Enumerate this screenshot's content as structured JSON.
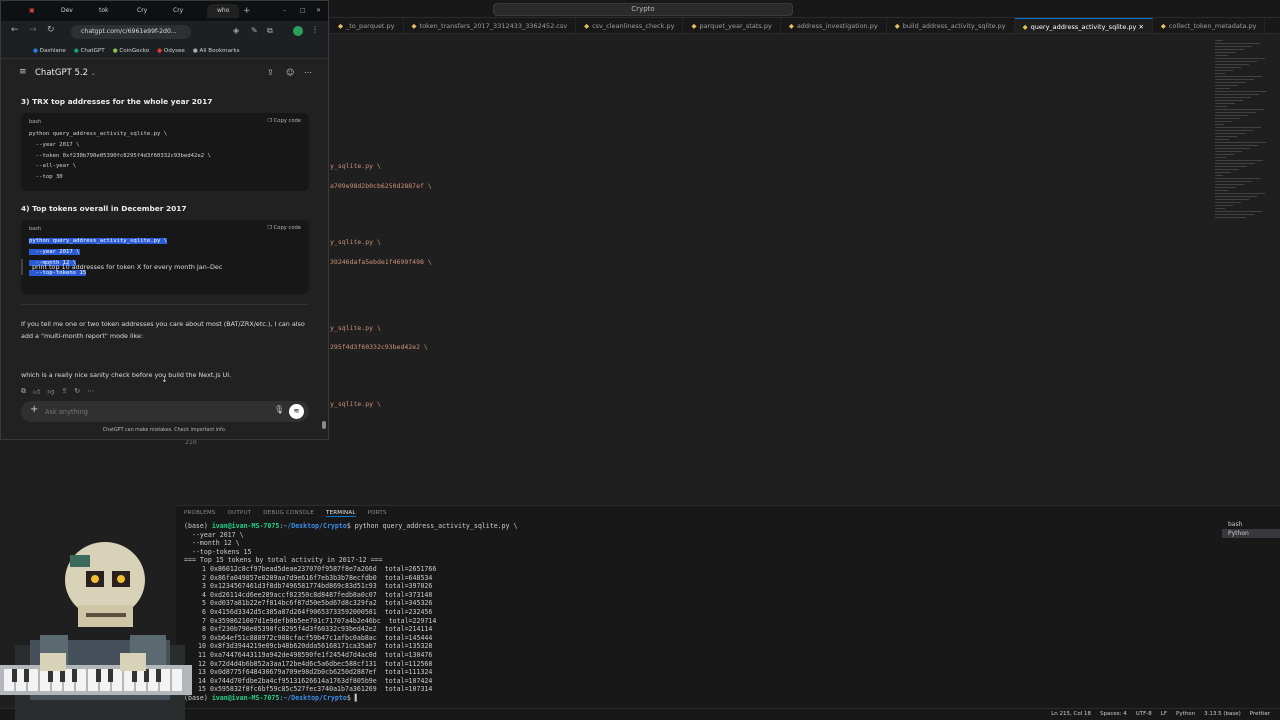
{
  "vscode": {
    "search_text": "Crypto",
    "tabs": [
      {
        "label": "_to_parquet.py",
        "active": false
      },
      {
        "label": "token_transfers_2017_3312433_3362452.csv",
        "active": false
      },
      {
        "label": "csv_cleanliness_check.py",
        "active": false
      },
      {
        "label": "parquet_year_stats.py",
        "active": false
      },
      {
        "label": "address_investigation.py",
        "active": false
      },
      {
        "label": "build_address_activity_sqlite.py",
        "active": false
      },
      {
        "label": "query_address_activity_sqlite.py",
        "active": true
      },
      {
        "label": "collect_token_metadata.py",
        "active": false
      }
    ],
    "code_fragments": [
      "y_sqlite.py \\",
      "a709e98d2b0cb6250d2887ef \\",
      "y_sqlite.py \\",
      "39246dafa5ebde1f4699f498 \\",
      "y_sqlite.py \\",
      "295f4d3f60332c93bed42e2 \\",
      "y_sqlite.py \\"
    ],
    "line_number": "210",
    "panel_tabs": [
      "PROBLEMS",
      "OUTPUT",
      "DEBUG CONSOLE",
      "TERMINAL",
      "PORTS"
    ],
    "terminal": {
      "prompt_user": "ivan@ivan-MS-7075",
      "prompt_path": "~/Desktop/Crypto",
      "env": "(base)",
      "command": "$ python query_address_activity_sqlite.py \\",
      "args": [
        "  --year 2017 \\",
        "  --month 12 \\",
        "  --top-tokens 15"
      ],
      "header": "=== Top 15 tokens by total activity in 2017-12 ===",
      "rows": [
        {
          "rank": "1",
          "address": "0x86012c8cf97bead5deae237070f9587f8e7a266d",
          "total": "total=2651766"
        },
        {
          "rank": "2",
          "address": "0x86fa049857e0209aa7d9e616f7eb3b3b78ecfdb0",
          "total": "total=648534"
        },
        {
          "rank": "3",
          "address": "0x1234567461d3f8db7496581774bd869c83d51c93",
          "total": "total=397026"
        },
        {
          "rank": "4",
          "address": "0xd26114cd6ee289accf82350c8d8487fedb8a0c07",
          "total": "total=373148"
        },
        {
          "rank": "5",
          "address": "0xd037a81b22e7f814bc6f87d50e5bd67d8c329fa2",
          "total": "total=345326"
        },
        {
          "rank": "6",
          "address": "0x4156d3342d5c385a87d264f90653733592000581",
          "total": "total=232456"
        },
        {
          "rank": "7",
          "address": "0x3598621007d1e9defb0b5ee701c71707a4b2e46bc",
          "total": "total=229714"
        },
        {
          "rank": "8",
          "address": "0xf230b790e05390fc8295f4d3f60332c93bed42e2",
          "total": "total=214114"
        },
        {
          "rank": "9",
          "address": "0xb64ef51c888972c908cfacf59b47c1afbc0ab8ac",
          "total": "total=145444"
        },
        {
          "rank": "10",
          "address": "0x8f3d3944219e09cb48b620dda56168171ca35ab7",
          "total": "total=135328"
        },
        {
          "rank": "11",
          "address": "0xa74476443119a942de498590fe1f2454d7d4ac0d",
          "total": "total=130476"
        },
        {
          "rank": "12",
          "address": "0x72d4d4b6b852a3aa172be4d6c5a6dbec588cf131",
          "total": "total=112568"
        },
        {
          "rank": "13",
          "address": "0x0d8775f648430679a709e98d2b0cb6250d2887ef",
          "total": "total=111324"
        },
        {
          "rank": "14",
          "address": "0x744d70fdbe2ba4cf95131626614a1763df805b9e",
          "total": "total=107424"
        },
        {
          "rank": "15",
          "address": "0x595832f8fc6bf59c85c527fec3740a1b7a361269",
          "total": "total=107314"
        }
      ],
      "final_prompt": "$"
    },
    "terminal_list": [
      "bash",
      "Python"
    ],
    "status": [
      "Ln 215, Col 18",
      "Spaces: 4",
      "UTF-8",
      "LF",
      "Python",
      "3.13.5 (base)",
      "Prettier"
    ]
  },
  "chrome": {
    "tabs": [
      "Dev",
      "tok",
      "Cry",
      "Cry",
      "who"
    ],
    "url": "chatgpt.com/c/6961e99f-2d0...",
    "bookmarks": [
      "Dashlane",
      "ChatGPT",
      "CoinGecko",
      "Odysee",
      "All Bookmarks"
    ],
    "app_title": "ChatGPT 5.2",
    "sections": [
      {
        "heading": "3) TRX top addresses for the whole year 2017",
        "lang": "bash",
        "copy": "Copy code",
        "code": "python query_address_activity_sqlite.py \\\n  --year 2017 \\\n  --token 0xf230b790e05390fc8295f4d3f60332c93bed42e2 \\\n  --all-year \\\n  --top 30"
      },
      {
        "heading": "4) Top tokens overall in December 2017",
        "lang": "bash",
        "copy": "Copy code",
        "code": "python query_address_activity_sqlite.py \\\n  --year 2017 \\\n  --month 12 \\\n  --top-tokens 15"
      }
    ],
    "paragraph": "If you tell me one or two token addresses you care about most (BAT/ZRX/etc.), I can also add a \"multi-month report\" mode like:",
    "quote": "print top 10 addresses for token X for every month Jan–Dec",
    "closing": "which is a really nice sanity check before you build the Next.js UI.",
    "input_placeholder": "Ask anything",
    "footer": "ChatGPT can make mistakes. Check important info."
  }
}
